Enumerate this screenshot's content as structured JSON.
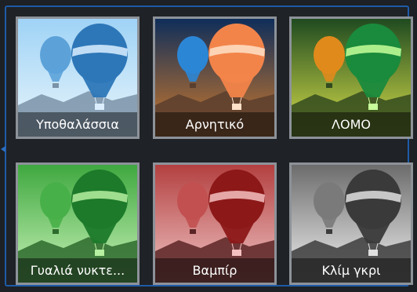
{
  "effects": [
    {
      "label": "Υποθαλάσσια",
      "sky_top": "#9fd3f6",
      "sky_bottom": "#e9f5fb",
      "ground": "#7b93a8",
      "balloon_big": "#2d77b8",
      "balloon_small": "#5ca2d9",
      "stripe": "#dbeeff"
    },
    {
      "label": "Αρνητικό",
      "sky_top": "#0f2e5a",
      "sky_bottom": "#d07a2a",
      "ground": "#5a3e2e",
      "balloon_big": "#f2844a",
      "balloon_small": "#2c86d6",
      "stripe": "#ffe0c8"
    },
    {
      "label": "ΛΟΜΟ",
      "sky_top": "#1f4a20",
      "sky_bottom": "#d9e04a",
      "ground": "#324a1f",
      "balloon_big": "#1a8a3c",
      "balloon_small": "#e08a1c",
      "stripe": "#c8ff9a"
    },
    {
      "label": "Γυαλιά νυκτε...",
      "sky_top": "#3fa83f",
      "sky_bottom": "#c8f2b8",
      "ground": "#2d6a2d",
      "balloon_big": "#1c7a2a",
      "balloon_small": "#48b048",
      "stripe": "#b6f0a0"
    },
    {
      "label": "Βαμπίρ",
      "sky_top": "#b34040",
      "sky_bottom": "#f0c4c4",
      "ground": "#5a2424",
      "balloon_big": "#8c1818",
      "balloon_small": "#c25050",
      "stripe": "#f5c0c0"
    },
    {
      "label": "Κλίμ γκρι",
      "sky_top": "#6c6c6c",
      "sky_bottom": "#f2f2f2",
      "ground": "#3c3c3c",
      "balloon_big": "#3a3a3a",
      "balloon_small": "#7a7a7a",
      "stripe": "#e0e0e0"
    }
  ]
}
